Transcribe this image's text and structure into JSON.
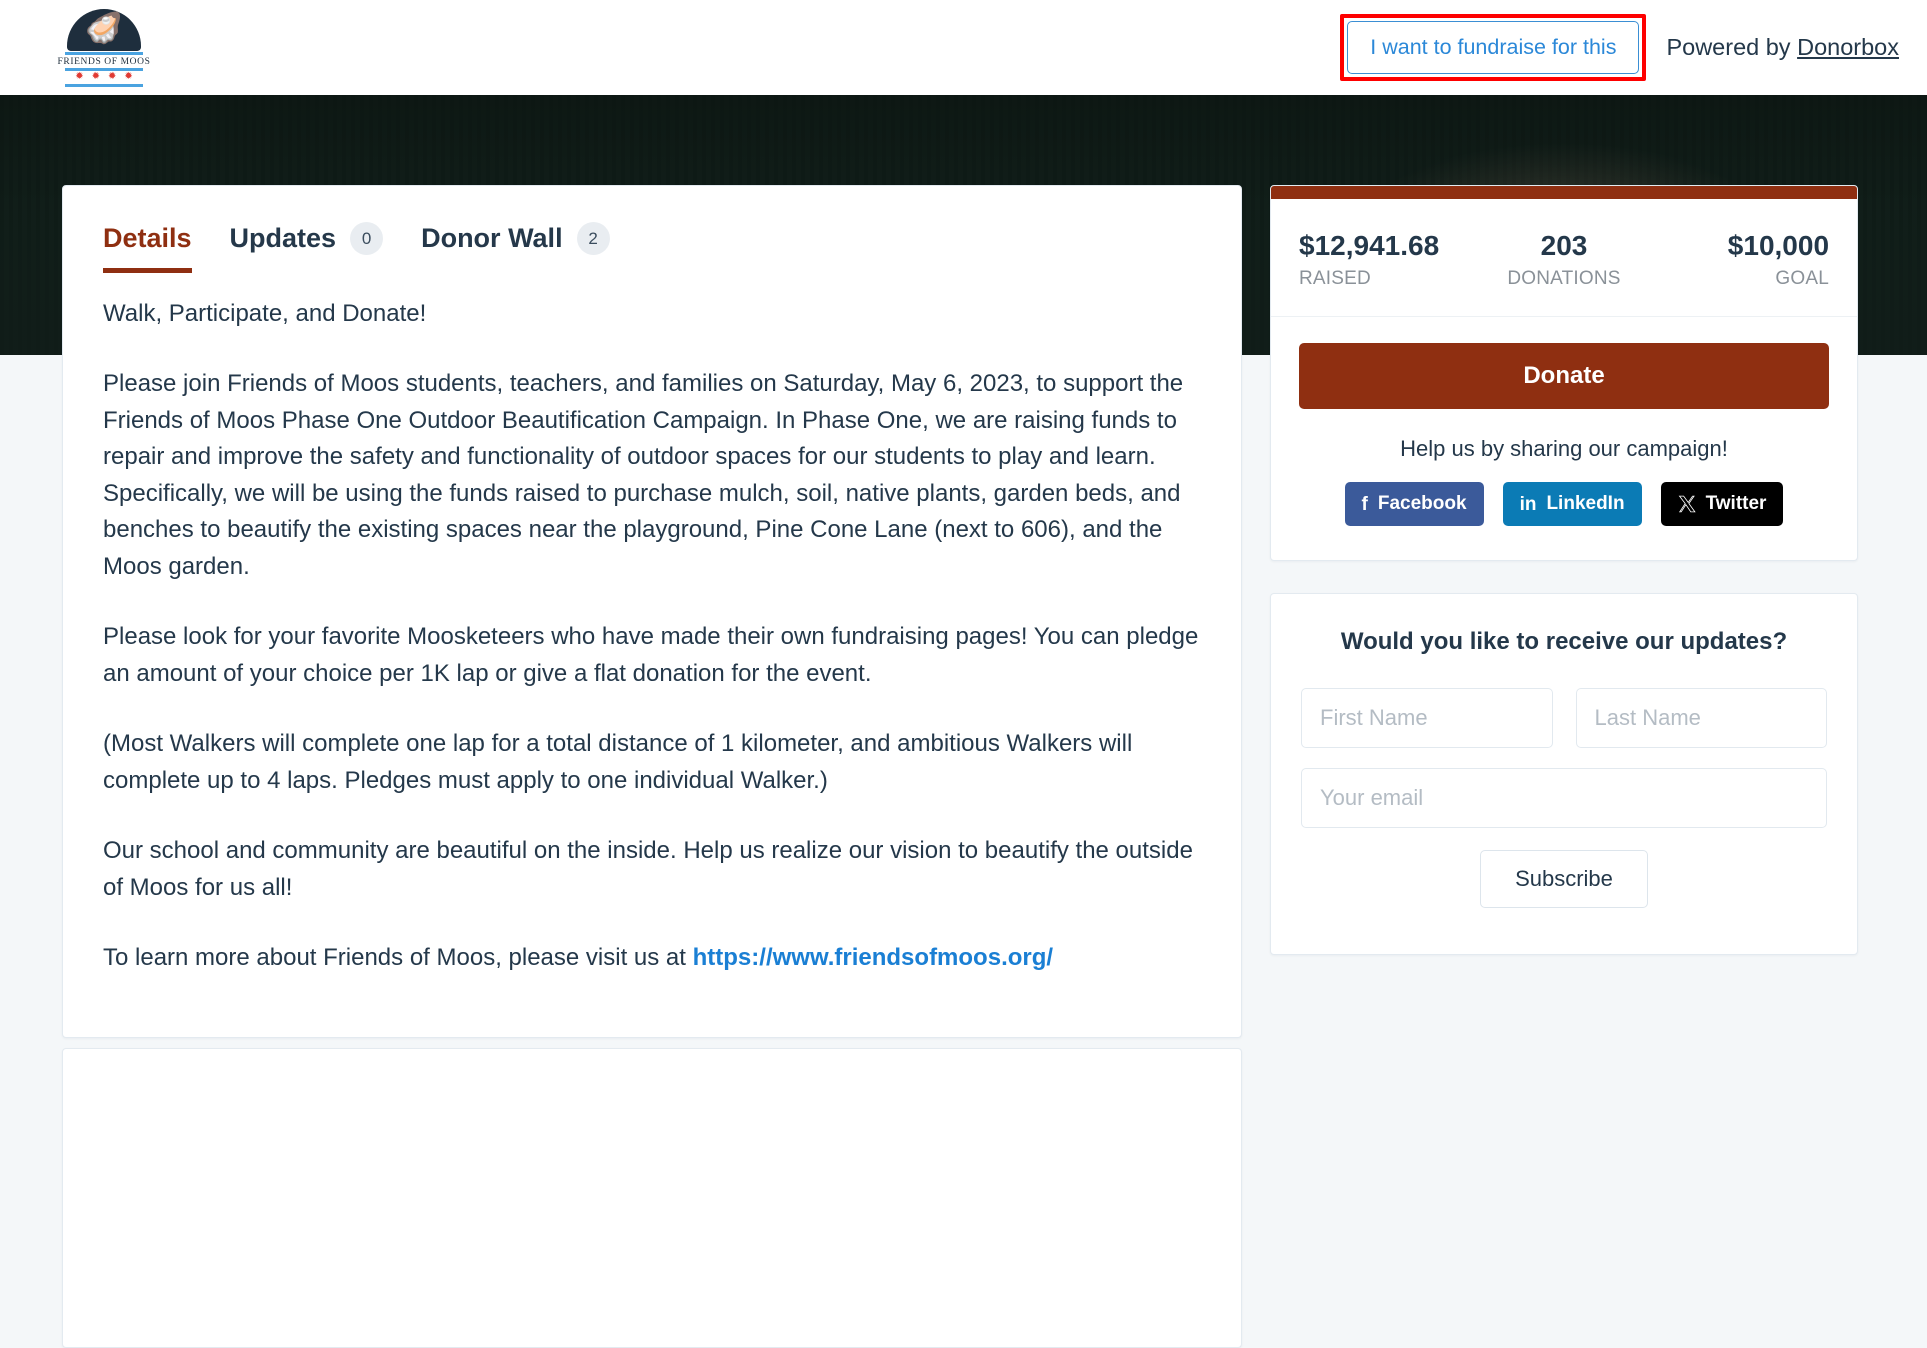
{
  "header": {
    "logo": {
      "org_name": "FRIENDS OF MOOS",
      "moose_icon": "moose-icon",
      "star_glyph": "✹",
      "stars_count": 4
    },
    "fundraise_button": "I want to fundraise for this",
    "powered_by_prefix": "Powered by ",
    "powered_by_brand": "Donorbox",
    "highlight_color": "#fe0000",
    "link_color": "#2b88d8"
  },
  "tabs": [
    {
      "label": "Details",
      "badge": null,
      "active": true
    },
    {
      "label": "Updates",
      "badge": "0",
      "active": false
    },
    {
      "label": "Donor Wall",
      "badge": "2",
      "active": false
    }
  ],
  "content": {
    "paragraphs": [
      "Walk, Participate, and Donate!",
      "Please join Friends of Moos students, teachers, and families on Saturday, May 6, 2023, to support the Friends of Moos Phase One Outdoor Beautification Campaign. In Phase One, we are raising funds to repair and improve the safety and functionality of outdoor spaces for our students to play and learn. Specifically, we will be using the funds raised to purchase mulch, soil, native plants, garden beds, and benches to beautify the existing spaces near the playground, Pine Cone Lane (next to 606), and the Moos garden.",
      "Please look for your favorite Moosketeers who have made their own fundraising pages!  You can pledge an amount of your choice per 1K lap or give a flat donation for the event.",
      "(Most Walkers will complete one lap for a total distance of 1 kilometer, and ambitious Walkers will complete up to 4 laps.  Pledges must apply to one individual Walker.)",
      "Our school and community are beautiful on the inside.  Help us realize our vision to beautify the outside of Moos for us all!"
    ],
    "final_paragraph_prefix": "To learn more about Friends of Moos, please visit us at ",
    "final_paragraph_link": "https://www.friendsofmoos.org/"
  },
  "sidebar": {
    "stats": {
      "accent_color": "#8f2f11",
      "items": [
        {
          "value": "$12,941.68",
          "label": "RAISED"
        },
        {
          "value": "203",
          "label": "DONATIONS"
        },
        {
          "value": "$10,000",
          "label": "GOAL"
        }
      ]
    },
    "donate_button": "Donate",
    "share_title": "Help us by sharing our campaign!",
    "share_buttons": [
      {
        "label": "Facebook",
        "icon": "facebook-icon",
        "glyph": "f",
        "color": "#3b5a9a"
      },
      {
        "label": "LinkedIn",
        "icon": "linkedin-icon",
        "glyph": "in",
        "color": "#0b7bb5"
      },
      {
        "label": "Twitter",
        "icon": "twitter-x-icon",
        "glyph": "X",
        "color": "#000000"
      }
    ],
    "newsletter": {
      "title": "Would you like to receive our updates?",
      "first_name_placeholder": "First Name",
      "last_name_placeholder": "Last Name",
      "email_placeholder": "Your email",
      "subscribe_button": "Subscribe"
    }
  }
}
